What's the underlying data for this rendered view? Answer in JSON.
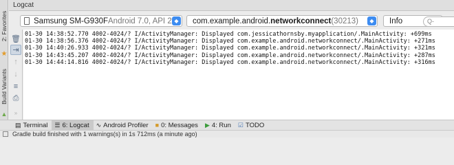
{
  "panel": {
    "title": "Logcat"
  },
  "left_strip": {
    "tab1": "2: Favorites",
    "tab2": "Build Variants"
  },
  "device_bar": {
    "device_name": "Samsung SM-G930F",
    "device_detail": " Android 7.0, API 24",
    "process_prefix": "com.example.android.",
    "process_bold": "networkconnect",
    "process_pid": " (30213)",
    "log_level": "Info",
    "search_placeholder": "Q-"
  },
  "log_lines": [
    "01-30 14:38:52.770 4002-4024/? I/ActivityManager: Displayed com.jessicathornsby.myapplication/.MainActivity: +699ms",
    "01-30 14:38:56.376 4002-4024/? I/ActivityManager: Displayed com.example.android.networkconnect/.MainActivity: +271ms",
    "01-30 14:40:26.933 4002-4024/? I/ActivityManager: Displayed com.example.android.networkconnect/.MainActivity: +321ms",
    "01-30 14:43:45.207 4002-4024/? I/ActivityManager: Displayed com.example.android.networkconnect/.MainActivity: +287ms",
    "01-30 14:44:14.816 4002-4024/? I/ActivityManager: Displayed com.example.android.networkconnect/.MainActivity: +316ms"
  ],
  "bottom_tabs": {
    "terminal": "Terminal",
    "logcat": "6: Logcat",
    "profiler": "Android Profiler",
    "messages": "0: Messages",
    "run": "4: Run",
    "todo": "TODO"
  },
  "status": {
    "text": "Gradle build finished with 1 warnings(s) in 1s 712ms (a minute ago)"
  }
}
